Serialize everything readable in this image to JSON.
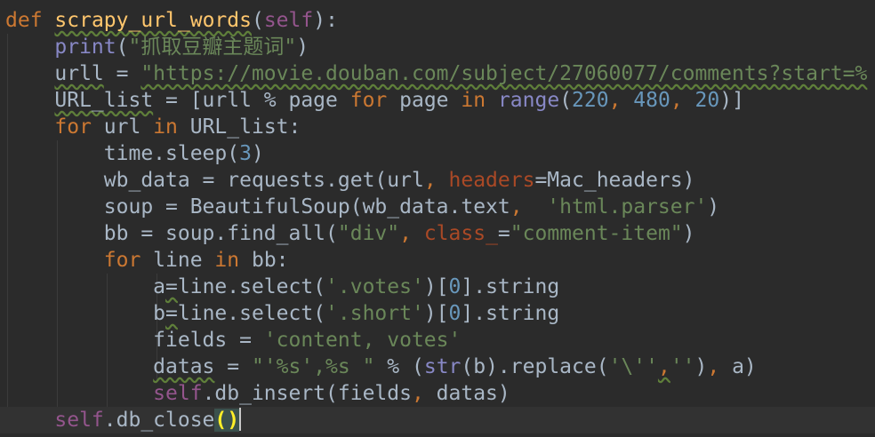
{
  "editor": {
    "colors": {
      "background": "#2b2b2b",
      "text": "#a9b7c6",
      "keyword": "#cc7832",
      "function": "#ffc66d",
      "string": "#6a8759",
      "number": "#6897bb",
      "self": "#94558d",
      "builtin": "#8888c6",
      "parameter": "#aa4926"
    },
    "lines": [
      [
        {
          "t": "def",
          "c": "kw"
        },
        {
          "t": " "
        },
        {
          "t": "scrapy_url_words",
          "c": "fn wavy"
        },
        {
          "t": "("
        },
        {
          "t": "self",
          "c": "self"
        },
        {
          "t": "):"
        }
      ],
      [
        {
          "t": "    "
        },
        {
          "t": "print",
          "c": "builtin"
        },
        {
          "t": "("
        },
        {
          "t": "\"抓取豆瓣主题词\"",
          "c": "str"
        },
        {
          "t": ")"
        }
      ],
      [
        {
          "t": "    "
        },
        {
          "t": "urll",
          "c": "wavy"
        },
        {
          "t": " = "
        },
        {
          "t": "\"https://movie.douban.com/subject/27060077/comments?start=%",
          "c": "str wavy"
        }
      ],
      [
        {
          "t": "    "
        },
        {
          "t": "URL_list",
          "c": "wavy"
        },
        {
          "t": " = [urll % page "
        },
        {
          "t": "for",
          "c": "kw"
        },
        {
          "t": " page "
        },
        {
          "t": "in",
          "c": "kw"
        },
        {
          "t": " "
        },
        {
          "t": "range",
          "c": "builtin"
        },
        {
          "t": "("
        },
        {
          "t": "220",
          "c": "num"
        },
        {
          "t": ", ",
          "c": "kw"
        },
        {
          "t": "480",
          "c": "num"
        },
        {
          "t": ", ",
          "c": "kw"
        },
        {
          "t": "20",
          "c": "num"
        },
        {
          "t": ")]"
        }
      ],
      [
        {
          "t": "    "
        },
        {
          "t": "for",
          "c": "kw"
        },
        {
          "t": " url "
        },
        {
          "t": "in",
          "c": "kw"
        },
        {
          "t": " URL_list:"
        }
      ],
      [
        {
          "t": "        time.sleep("
        },
        {
          "t": "3",
          "c": "num"
        },
        {
          "t": ")"
        }
      ],
      [
        {
          "t": "        wb_data = requests.get(url"
        },
        {
          "t": ", ",
          "c": "kw"
        },
        {
          "t": "headers",
          "c": "param"
        },
        {
          "t": "=Mac_headers)"
        }
      ],
      [
        {
          "t": "        soup = BeautifulSoup(wb_data.text"
        },
        {
          "t": ",  ",
          "c": "kw"
        },
        {
          "t": "'html.parser'",
          "c": "str"
        },
        {
          "t": ")"
        }
      ],
      [
        {
          "t": "        bb = soup.find_all("
        },
        {
          "t": "\"div\"",
          "c": "str"
        },
        {
          "t": ", ",
          "c": "kw"
        },
        {
          "t": "class_",
          "c": "param"
        },
        {
          "t": "="
        },
        {
          "t": "\"comment-item\"",
          "c": "str"
        },
        {
          "t": ")"
        }
      ],
      [
        {
          "t": "        "
        },
        {
          "t": "for",
          "c": "kw"
        },
        {
          "t": " line "
        },
        {
          "t": "in",
          "c": "kw"
        },
        {
          "t": " bb:"
        }
      ],
      [
        {
          "t": "            a"
        },
        {
          "t": "=",
          "c": "wavy"
        },
        {
          "t": "line.select("
        },
        {
          "t": "'.votes'",
          "c": "str"
        },
        {
          "t": ")["
        },
        {
          "t": "0",
          "c": "num"
        },
        {
          "t": "].string"
        }
      ],
      [
        {
          "t": "            b"
        },
        {
          "t": "=",
          "c": "wavy"
        },
        {
          "t": "line.select("
        },
        {
          "t": "'.short'",
          "c": "str"
        },
        {
          "t": ")["
        },
        {
          "t": "0",
          "c": "num"
        },
        {
          "t": "].string"
        }
      ],
      [
        {
          "t": "            fields = "
        },
        {
          "t": "'content, votes'",
          "c": "str"
        }
      ],
      [
        {
          "t": "            "
        },
        {
          "t": "datas",
          "c": "wavy"
        },
        {
          "t": " = "
        },
        {
          "t": "\"'%s',%s \"",
          "c": "str"
        },
        {
          "t": " % ("
        },
        {
          "t": "str",
          "c": "builtin"
        },
        {
          "t": "(b).replace("
        },
        {
          "t": "'\\''",
          "c": "str"
        },
        {
          "t": ",",
          "c": "kw wavy"
        },
        {
          "t": "''",
          "c": "str"
        },
        {
          "t": ")"
        },
        {
          "t": ", ",
          "c": "kw"
        },
        {
          "t": "a)"
        }
      ],
      [
        {
          "t": "            "
        },
        {
          "t": "self",
          "c": "self"
        },
        {
          "t": ".db_insert(fields"
        },
        {
          "t": ", ",
          "c": "kw"
        },
        {
          "t": "datas)"
        }
      ],
      [
        {
          "t": "    "
        },
        {
          "t": "self",
          "c": "self"
        },
        {
          "t": ".db_close"
        },
        {
          "t": "()",
          "c": "brace"
        }
      ]
    ]
  }
}
